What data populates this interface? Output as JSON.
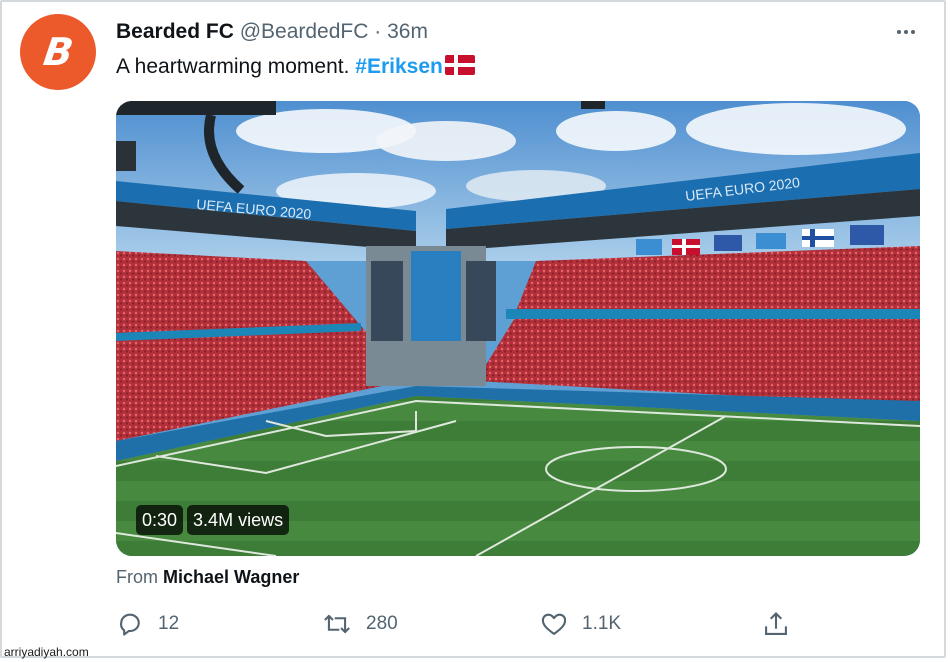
{
  "tweet": {
    "display_name": "Bearded FC",
    "handle": "@BeardedFC",
    "separator": "·",
    "time": "36m",
    "avatar_letter": "B",
    "avatar_color": "#ec5a2c",
    "text": "A heartwarming moment.",
    "hashtag": "#Eriksen",
    "hashtag_color": "#1d9bf0",
    "flag": "denmark-flag"
  },
  "media": {
    "duration": "0:30",
    "views": "3.4M views",
    "banner_text": "UEFA EURO 2020",
    "banner_text_2": "UEFA EURO 2020"
  },
  "attribution": {
    "label": "From",
    "name": "Michael Wagner"
  },
  "actions": {
    "reply": {
      "icon": "reply-icon",
      "count": "12"
    },
    "retweet": {
      "icon": "retweet-icon",
      "count": "280"
    },
    "like": {
      "icon": "heart-icon",
      "count": "1.1K"
    },
    "share": {
      "icon": "share-icon"
    }
  },
  "watermark": "arriyadiyah.com"
}
